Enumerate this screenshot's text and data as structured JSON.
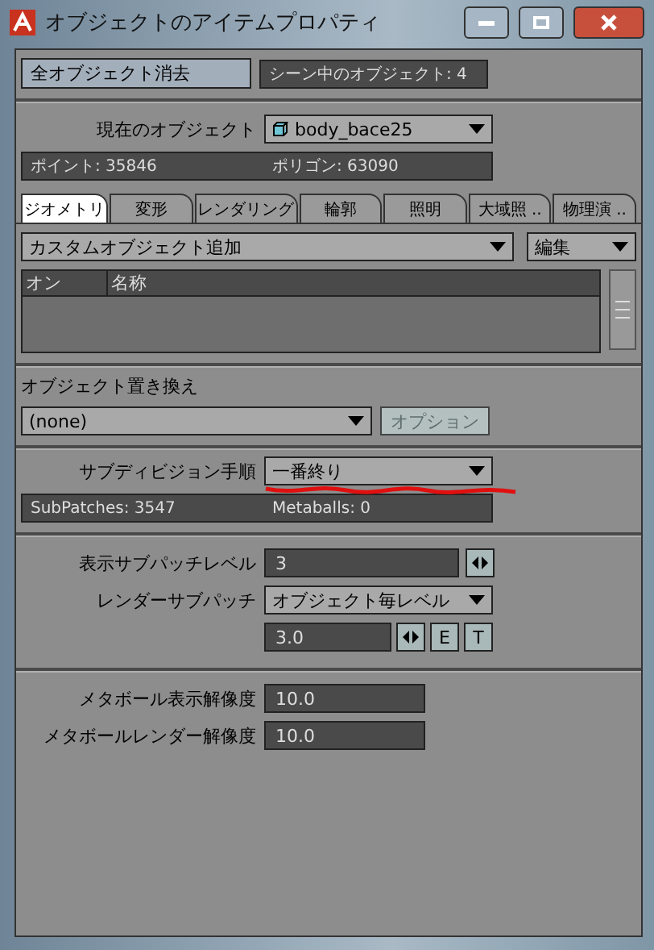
{
  "window": {
    "title": "オブジェクトのアイテムプロパティ"
  },
  "top": {
    "clear_button": "全オブジェクト消去",
    "scene_count": "シーン中のオブジェクト: 4"
  },
  "current": {
    "label": "現在のオブジェクト",
    "value": "body_bace25",
    "points": "ポイント: 35846",
    "polygons": "ポリゴン: 63090"
  },
  "tabs": [
    {
      "label": "ジオメトリ",
      "selected": true
    },
    {
      "label": "変形",
      "selected": false
    },
    {
      "label": "レンダリング",
      "selected": false
    },
    {
      "label": "輪郭",
      "selected": false
    },
    {
      "label": "照明",
      "selected": false
    },
    {
      "label": "大域照 ..",
      "selected": false
    },
    {
      "label": "物理演 ..",
      "selected": false
    }
  ],
  "custom": {
    "dropdown": "カスタムオブジェクト追加",
    "edit": "編集",
    "columns": [
      "オン",
      "名称"
    ]
  },
  "replace": {
    "label": "オブジェクト置き換え",
    "dropdown": "(none)",
    "options_button": {
      "label": "オプション",
      "disabled": true
    }
  },
  "subdivision": {
    "label": "サブディビジョン手順",
    "value": "一番終り",
    "subpatches": "SubPatches: 3547",
    "metaballs": "Metaballs: 0"
  },
  "subpatch": {
    "display_label": "表示サブパッチレベル",
    "display_value": "3",
    "render_label": "レンダーサブパッチ",
    "render_mode": "オブジェクト毎レベル",
    "render_value": "3.0",
    "envelope": "E",
    "texture": "T"
  },
  "metaball": {
    "display_label": "メタボール表示解像度",
    "display_value": "10.0",
    "render_label": "メタボールレンダー解像度",
    "render_value": "10.0"
  }
}
